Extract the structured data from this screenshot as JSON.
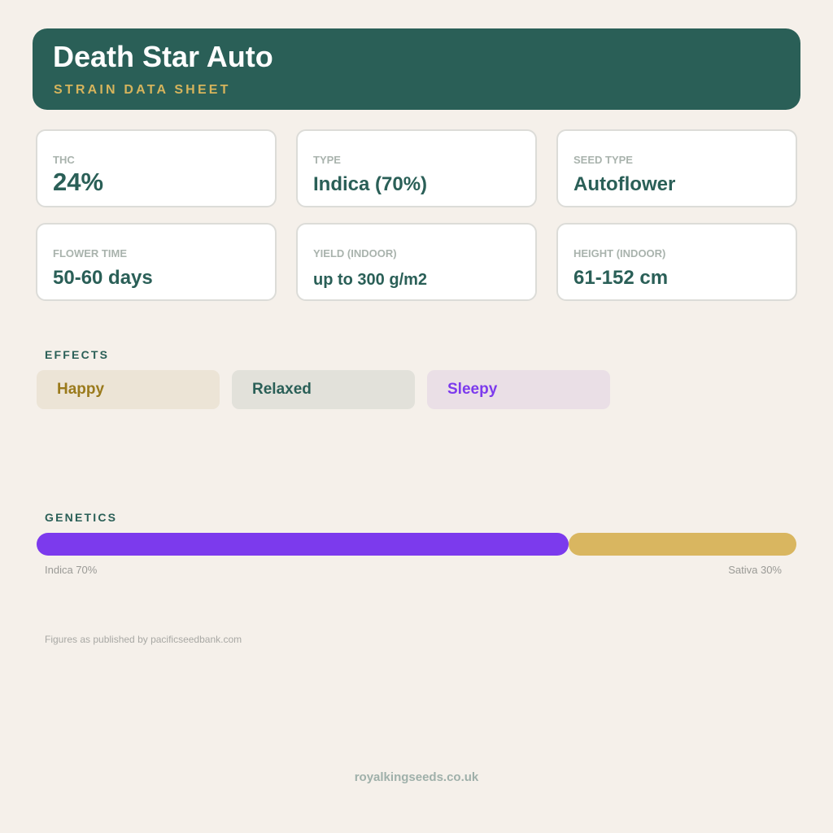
{
  "header": {
    "title": "Death Star Auto",
    "subtitle": "STRAIN DATA SHEET"
  },
  "stats": [
    {
      "label": "THC",
      "value": "24%"
    },
    {
      "label": "TYPE",
      "value": "Indica (70%)"
    },
    {
      "label": "SEED TYPE",
      "value": "Autoflower"
    },
    {
      "label": "FLOWER TIME",
      "value": "50-60 days"
    },
    {
      "label": "YIELD (INDOOR)",
      "value": "up to 300 g/m2"
    },
    {
      "label": "HEIGHT (INDOOR)",
      "value": "61-152 cm"
    }
  ],
  "effects": {
    "label": "EFFECTS",
    "items": [
      {
        "label": "Happy",
        "text_color": "#9a7a1c",
        "bg_color": "#ece4d6"
      },
      {
        "label": "Relaxed",
        "text_color": "#2a5f57",
        "bg_color": "#e2e1da"
      },
      {
        "label": "Sleepy",
        "text_color": "#7c3aed",
        "bg_color": "#eadfe6"
      }
    ]
  },
  "genetics": {
    "label": "GENETICS",
    "indica_percent": 70,
    "sativa_percent": 30,
    "indica_label": "Indica 70%",
    "sativa_label": "Sativa 30%",
    "indica_color": "#7c3aed",
    "sativa_color": "#d9b660"
  },
  "source_note": "Figures as published by pacificseedbank.com",
  "footer": "royalkingseeds.co.uk",
  "colors": {
    "brand": "#2a5f57",
    "accent": "#d6b45c",
    "background": "#f5f0ea"
  }
}
